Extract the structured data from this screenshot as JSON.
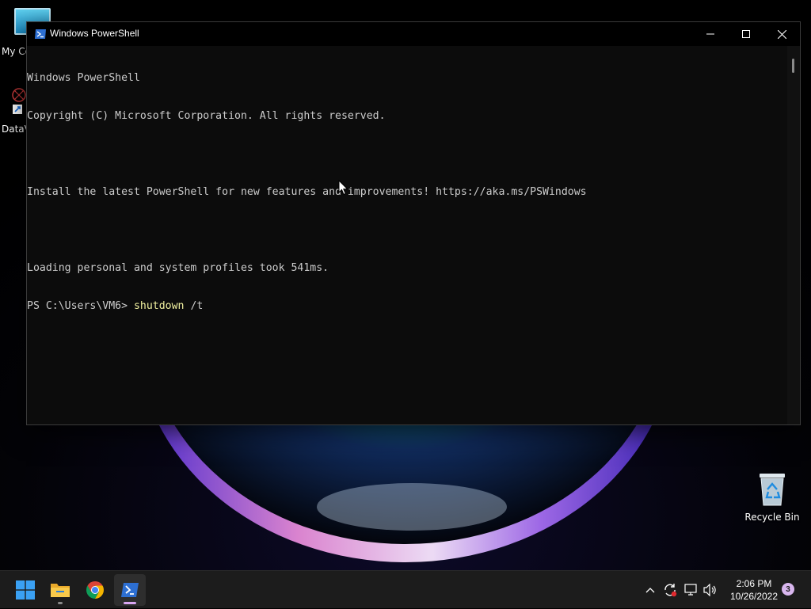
{
  "window": {
    "title": "Windows PowerShell"
  },
  "terminal": {
    "lines": [
      "Windows PowerShell",
      "Copyright (C) Microsoft Corporation. All rights reserved.",
      "",
      "Install the latest PowerShell for new features and improvements! https://aka.ms/PSWindows",
      "",
      "Loading personal and system profiles took 541ms."
    ],
    "prompt": "PS C:\\Users\\VM6> ",
    "command": "shutdown",
    "argument": " /t"
  },
  "desktop": {
    "icons": [
      {
        "label": "My Co",
        "icon": "monitor-icon"
      },
      {
        "label": "DataV",
        "icon": "datav-icon"
      },
      {
        "label": "Recycle Bin",
        "icon": "recycle-bin-icon"
      }
    ]
  },
  "taskbar": {
    "apps": [
      {
        "name": "Start",
        "icon": "windows-logo-icon"
      },
      {
        "name": "File Explorer",
        "icon": "folder-icon"
      },
      {
        "name": "Google Chrome",
        "icon": "chrome-icon"
      },
      {
        "name": "Windows PowerShell",
        "icon": "powershell-icon"
      }
    ],
    "tray": {
      "time": "2:06 PM",
      "date": "10/26/2022",
      "notifications": "3"
    }
  },
  "colors": {
    "terminal_bg": "#0c0c0c",
    "terminal_fg": "#cccccc",
    "command_fg": "#f2f2a0",
    "taskbar_bg": "#1c1c1c",
    "accent": "#d8b6ee"
  }
}
